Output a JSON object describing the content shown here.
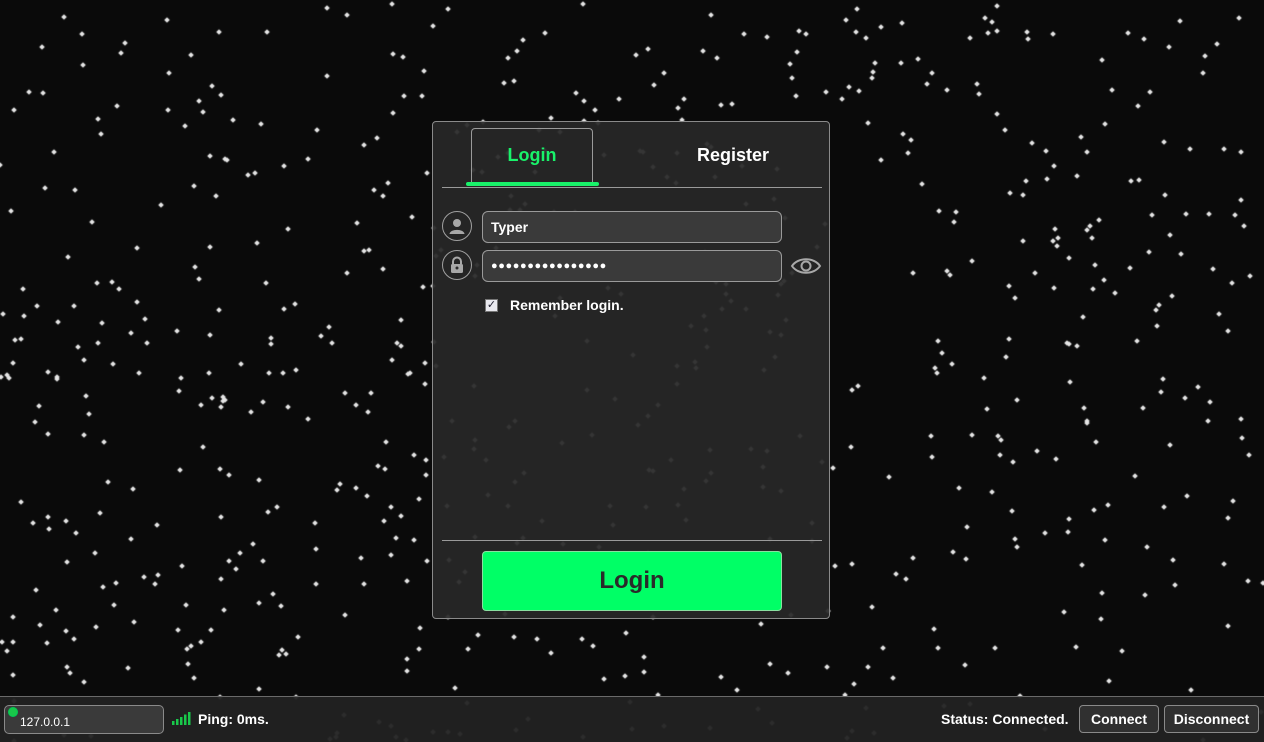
{
  "tabs": {
    "login_label": "Login",
    "register_label": "Register",
    "active": "login"
  },
  "form": {
    "username_value": "Typer",
    "password_masked": "●●●●●●●●●●●●●●●●",
    "remember_label": "Remember login.",
    "remember_checked": true,
    "submit_label": "Login"
  },
  "icons": {
    "username": "user-icon",
    "password": "lock-icon",
    "reveal": "eye-icon",
    "signal": "signal-bars-icon"
  },
  "bottom_bar": {
    "server_address": "127.0.0.1",
    "ping_text": "Ping: 0ms.",
    "status_text": "Status: Connected.",
    "connect_label": "Connect",
    "disconnect_label": "Disconnect"
  },
  "colors": {
    "accent": "#19f26a",
    "button": "#00ff66",
    "background": "#0a0a0a",
    "panel": "#282828",
    "status_dot": "#19c84a"
  }
}
